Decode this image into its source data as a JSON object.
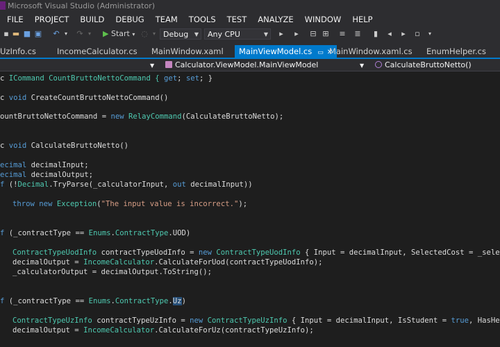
{
  "window": {
    "title": "Microsoft Visual Studio (Administrator)"
  },
  "menu": [
    "FILE",
    "PROJECT",
    "BUILD",
    "DEBUG",
    "TEAM",
    "TOOLS",
    "TEST",
    "ANALYZE",
    "WINDOW",
    "HELP"
  ],
  "toolbar": {
    "start_label": "Start",
    "config_value": "Debug",
    "platform_value": "Any CPU"
  },
  "tabs": [
    {
      "label": "UzInfo.cs"
    },
    {
      "label": "IncomeCalculator.cs"
    },
    {
      "label": "MainWindow.xaml"
    },
    {
      "label": "MainViewModel.cs",
      "active": true
    },
    {
      "label": "MainWindow.xaml.cs"
    },
    {
      "label": "EnumHelper.cs"
    }
  ],
  "navbar": {
    "scope": "Calculator.ViewModel.MainViewModel",
    "member": "CalculateBruttoNetto()"
  },
  "code": {
    "l1a": "c ",
    "l1b": "ICommand CountBruttoNettoCommand { ",
    "l1c": "get",
    "l1d": "; ",
    "l1e": "set",
    "l1f": "; }",
    "l2a": "c ",
    "l2b": "void",
    "l2c": " CreateCountBruttoNettoCommand()",
    "l3a": "ountBruttoNettoCommand = ",
    "l3b": "new",
    "l3c": " ",
    "l3d": "RelayCommand",
    "l3e": "(CalculateBruttoNetto);",
    "l4a": "c ",
    "l4b": "void",
    "l4c": " CalculateBruttoNetto()",
    "l5a": "ecimal",
    "l5b": " decimalInput;",
    "l6a": "ecimal",
    "l6b": " decimalOutput;",
    "l7a": "f",
    "l7b": " (!",
    "l7c": "Decimal",
    "l7d": ".TryParse(_calculatorInput, ",
    "l7e": "out",
    "l7f": " decimalInput))",
    "l8a": "throw",
    "l8b": " ",
    "l8c": "new",
    "l8d": " ",
    "l8e": "Exception",
    "l8f": "(",
    "l8g": "\"The input value is incorrect.\"",
    "l8h": ");",
    "l9a": "f",
    "l9b": " (_contractType == ",
    "l9c": "Enums",
    "l9d": ".",
    "l9e": "ContractType",
    "l9f": ".UOD)",
    "l10a": "ContractTypeUodInfo",
    "l10b": " contractTypeUodInfo = ",
    "l10c": "new",
    "l10d": " ",
    "l10e": "ContractTypeUodInfo",
    "l10f": " { Input = decimalInput, SelectedCost = _selectedC",
    "l11a": "decimalOutput = ",
    "l11b": "IncomeCalculator",
    "l11c": ".CalculateForUod(contractTypeUodInfo);",
    "l12a": "_calculatorOutput = decimalOutput.ToString();",
    "l13a": "f",
    "l13b": " (_contractType == ",
    "l13c": "Enums",
    "l13d": ".",
    "l13e": "ContractType",
    "l13f": ".",
    "l13g": "Uz",
    "l13h": ")",
    "l14a": "ContractTypeUzInfo",
    "l14b": " contractTypeUzInfo = ",
    "l14c": "new",
    "l14d": " ",
    "l14e": "ContractTypeUzInfo",
    "l14f": " { Input = decimalInput, IsStudent = ",
    "l14g": "true",
    "l14h": ", HasHealthI",
    "l15a": "decimalOutput = ",
    "l15b": "IncomeCalculator",
    "l15c": ".CalculateForUz(contractTypeUzInfo);"
  }
}
